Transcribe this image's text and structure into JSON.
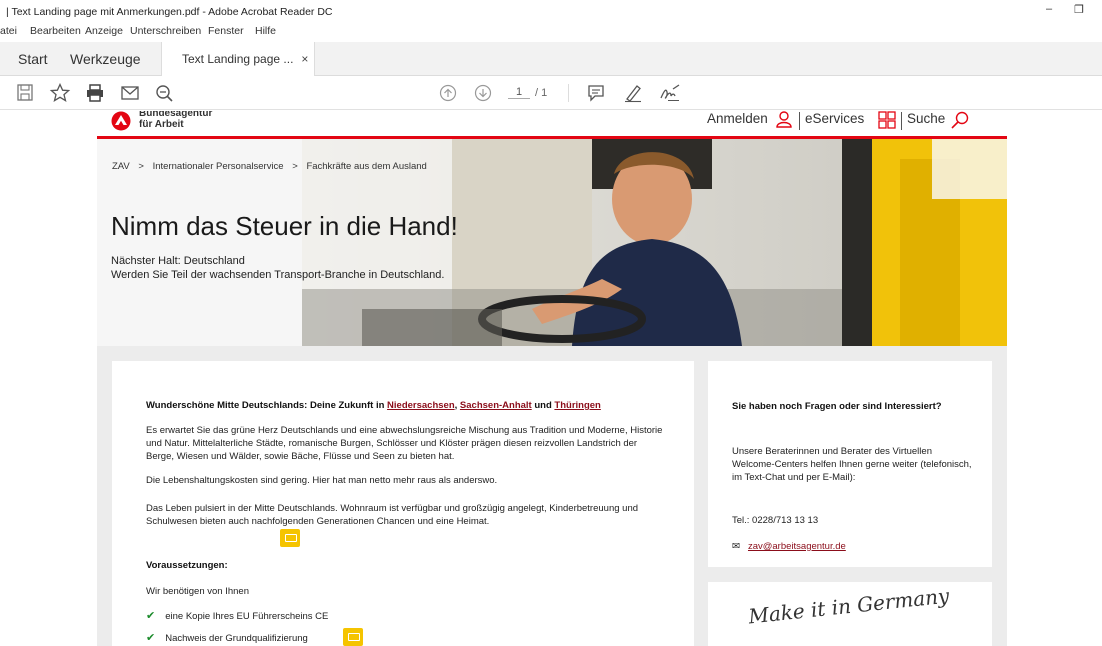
{
  "window": {
    "title": "| Text Landing page mit Anmerkungen.pdf - Adobe Acrobat Reader DC",
    "min_symbol": "–",
    "restore_symbol": "❐"
  },
  "menu": [
    "atei",
    "Bearbeiten",
    "Anzeige",
    "Unterschreiben",
    "Fenster",
    "Hilfe"
  ],
  "tabs": {
    "start": "Start",
    "tools": "Werkzeuge",
    "document": "Text Landing page ...",
    "close_symbol": "×"
  },
  "toolbar": {
    "page_current": "1",
    "page_total": "/ 1",
    "icons": [
      "save-icon",
      "bookmark-star-icon",
      "print-icon",
      "email-icon",
      "zoom-icon",
      "page-up-icon",
      "page-down-icon",
      "comment-icon",
      "highlight-pen-icon",
      "sign-icon"
    ]
  },
  "site": {
    "logo_line1": "Bundesagentur",
    "logo_line2": "für Arbeit",
    "nav_login": "Anmelden",
    "nav_eservices": "eServices",
    "nav_search": "Suche",
    "brand_red": "#e30613"
  },
  "hero": {
    "breadcrumb": [
      "ZAV",
      ">",
      "Internationaler Personalservice",
      ">",
      "Fachkräfte aus dem Ausland"
    ],
    "title": "Nimm das Steuer in die Hand!",
    "subtitle1": "Nächster Halt: Deutschland",
    "subtitle2": "Werden Sie Teil der wachsenden Transport-Branche in Deutschland."
  },
  "main": {
    "heading_prefix": "Wunderschöne Mitte Deutschlands: Deine Zukunft in ",
    "heading_link1": "Niedersachsen",
    "heading_sep1": ", ",
    "heading_link2": "Sachsen-Anhalt",
    "heading_sep2": " und ",
    "heading_link3": "Thüringen",
    "p1": "Es erwartet Sie das grüne Herz Deutschlands und eine abwechslungsreiche Mischung aus Tradition und Moderne, Historie und Natur. Mittelalterliche Städte, romanische Burgen, Schlösser und Klöster prägen diesen reizvollen Landstrich der Berge, Wiesen und Wälder, sowie Bäche, Flüsse und Seen zu bieten hat.",
    "p2": "Die Lebenshaltungskosten sind gering. Hier hat man netto mehr raus als anderswo.",
    "p3": "Das Leben pulsiert in der Mitte Deutschlands. Wohnraum ist verfügbar und großzügig angelegt, Kinderbetreuung und Schulwesen bieten auch nachfolgenden Generationen Chancen und eine Heimat.",
    "requirements_heading": "Voraussetzungen:",
    "requirements_intro": "Wir benötigen von Ihnen",
    "requirements": [
      "eine Kopie Ihres EU Führerscheins CE",
      "Nachweis der Grundqualifizierung"
    ]
  },
  "side": {
    "heading": "Sie haben noch Fragen oder sind Interessiert?",
    "text": "Unsere Beraterinnen und Berater des Virtuellen Welcome-Centers helfen Ihnen gerne weiter (telefonisch, im Text-Chat und per E-Mail):",
    "tel": "Tel.: 0228/713 13 13",
    "email": "zav@arbeitsagentur.de",
    "signature": "Make it in Germany"
  }
}
